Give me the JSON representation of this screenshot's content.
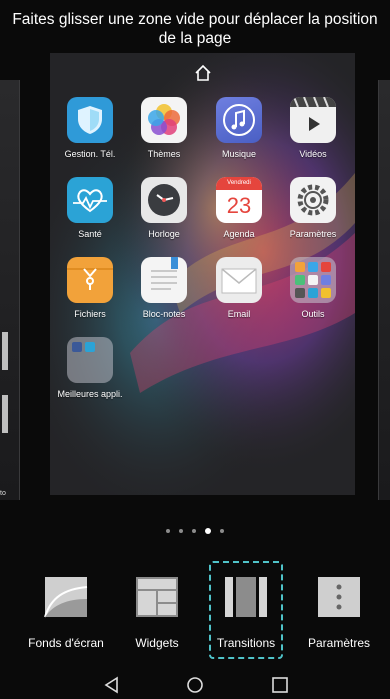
{
  "hint_text": "Faites glisser une zone vide pour déplacer la position de la page",
  "left_peek_label": "to",
  "apps": [
    {
      "label": "Gestion. Tél.",
      "icon": "shield-icon"
    },
    {
      "label": "Thèmes",
      "icon": "themes-flower-icon"
    },
    {
      "label": "Musique",
      "icon": "music-note-icon"
    },
    {
      "label": "Vidéos",
      "icon": "video-play-icon"
    },
    {
      "label": "Santé",
      "icon": "health-heart-icon"
    },
    {
      "label": "Horloge",
      "icon": "clock-icon"
    },
    {
      "label": "Agenda",
      "icon": "calendar-icon",
      "badge_month": "Vendredi",
      "badge_day": "23"
    },
    {
      "label": "Paramètres",
      "icon": "settings-gear-icon"
    },
    {
      "label": "Fichiers",
      "icon": "files-folder-icon"
    },
    {
      "label": "Bloc-notes",
      "icon": "notepad-icon"
    },
    {
      "label": "Email",
      "icon": "email-envelope-icon"
    },
    {
      "label": "Outils",
      "icon": "tools-folder-icon"
    },
    {
      "label": "Meilleures appli.",
      "icon": "top-apps-folder-icon"
    }
  ],
  "page_dots": {
    "count": 5,
    "active_index": 3
  },
  "options": [
    {
      "label": "Fonds d'écran",
      "icon": "wallpaper-icon"
    },
    {
      "label": "Widgets",
      "icon": "widgets-icon"
    },
    {
      "label": "Transitions",
      "icon": "transitions-icon",
      "highlighted": true
    },
    {
      "label": "Paramètres",
      "icon": "more-settings-icon"
    }
  ],
  "colors": {
    "highlight": "#4fc3c9",
    "background": "#0a0a0a"
  }
}
